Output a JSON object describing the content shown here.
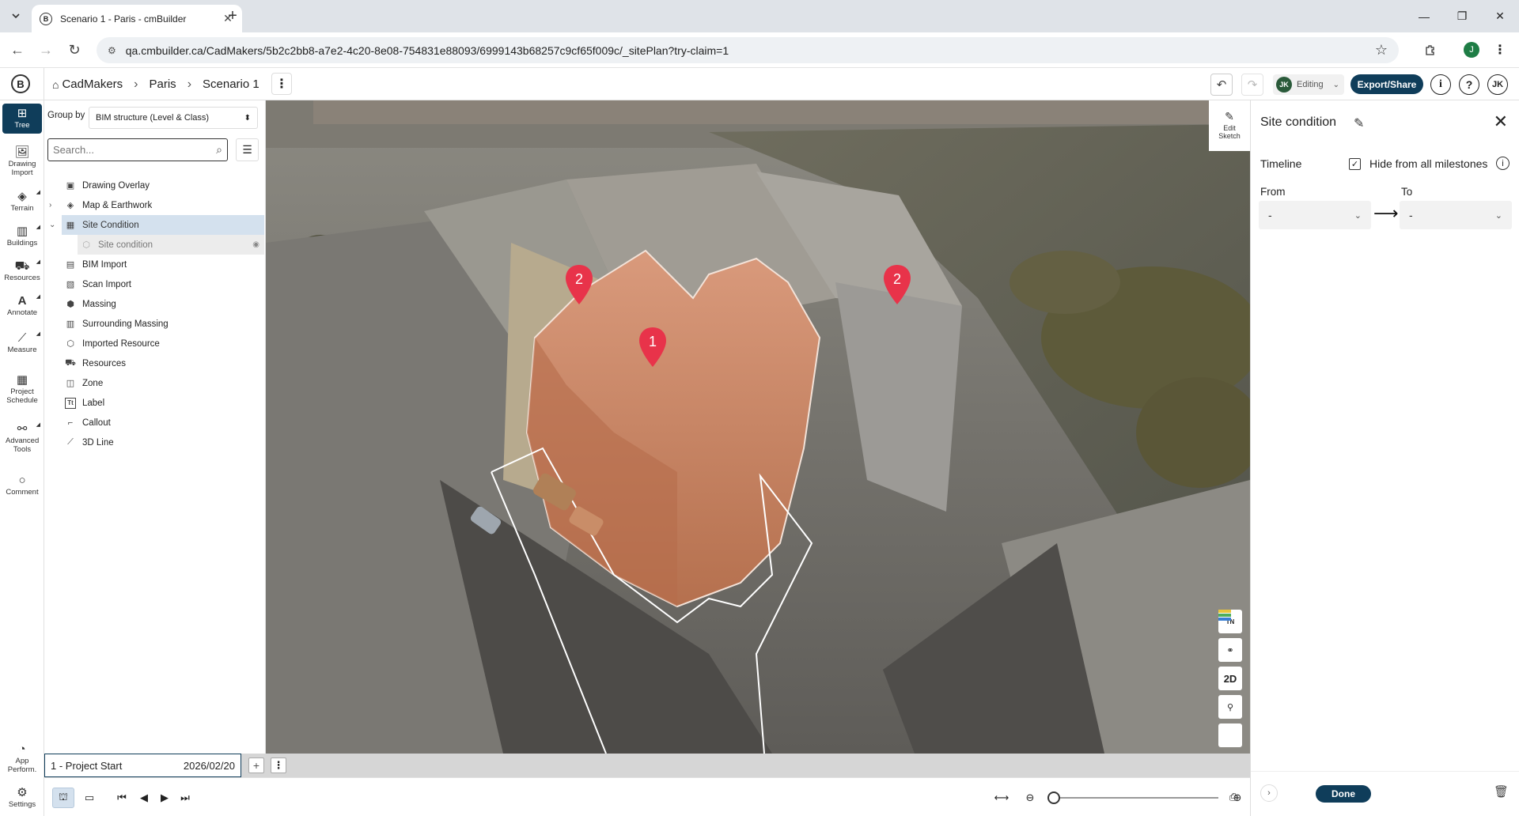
{
  "browser": {
    "tab_title": "Scenario 1 - Paris - cmBuilder",
    "url": "qa.cmbuilder.ca/CadMakers/5b2c2bb8-a7e2-4c20-8e08-754831e88093/6999143b68257c9cf65f009c/_sitePlan?try-claim=1",
    "profile_initial": "J"
  },
  "app": {
    "logo": "B",
    "breadcrumbs": [
      "CadMakers",
      "Paris",
      "Scenario 1"
    ],
    "editing_label": "Editing",
    "editing_avatar": "JK",
    "export_label": "Export/Share",
    "user_initials": "JK",
    "accent_color": "#0f3d5a"
  },
  "left_toolbar": [
    {
      "label": "Tree",
      "icon": "tree-icon"
    },
    {
      "label": "Drawing Import",
      "icon": "drawing-import-icon"
    },
    {
      "label": "Terrain",
      "icon": "terrain-icon"
    },
    {
      "label": "Buildings",
      "icon": "buildings-icon"
    },
    {
      "label": "Resources",
      "icon": "resources-icon"
    },
    {
      "label": "Annotate",
      "icon": "annotate-icon"
    },
    {
      "label": "Measure",
      "icon": "measure-icon"
    },
    {
      "label": "Project Schedule",
      "icon": "schedule-icon"
    },
    {
      "label": "Advanced Tools",
      "icon": "advanced-tools-icon"
    },
    {
      "label": "Comment",
      "icon": "comment-icon"
    },
    {
      "label": "App Perform.",
      "icon": "performance-icon"
    },
    {
      "label": "Settings",
      "icon": "settings-icon"
    }
  ],
  "tree_panel": {
    "group_by_label": "Group by",
    "group_by_value": "BIM structure (Level & Class)",
    "search_placeholder": "Search...",
    "items": [
      {
        "label": "Drawing Overlay",
        "icon": "drawing-overlay-icon"
      },
      {
        "label": "Map & Earthwork",
        "icon": "map-icon"
      },
      {
        "label": "Site Condition",
        "icon": "site-condition-icon"
      },
      {
        "label": "Site condition",
        "icon": "cube-icon"
      },
      {
        "label": "BIM Import",
        "icon": "bim-import-icon"
      },
      {
        "label": "Scan Import",
        "icon": "scan-import-icon"
      },
      {
        "label": "Massing",
        "icon": "massing-icon"
      },
      {
        "label": "Surrounding Massing",
        "icon": "surrounding-massing-icon"
      },
      {
        "label": "Imported Resource",
        "icon": "imported-resource-icon"
      },
      {
        "label": "Resources",
        "icon": "resources-icon"
      },
      {
        "label": "Zone",
        "icon": "zone-icon"
      },
      {
        "label": "Label",
        "icon": "label-icon"
      },
      {
        "label": "Callout",
        "icon": "callout-icon"
      },
      {
        "label": "3D Line",
        "icon": "line-icon"
      }
    ]
  },
  "viewport": {
    "edit_sketch_label": "Edit Sketch",
    "markers": [
      "2",
      "1",
      "2"
    ],
    "view_tools": [
      "TN",
      "layers",
      "2D",
      "pin",
      "legend"
    ]
  },
  "right_panel": {
    "title": "Site condition",
    "timeline_label": "Timeline",
    "hide_label": "Hide from all milestones",
    "hide_checked": true,
    "from_label": "From",
    "to_label": "To",
    "from_value": "-",
    "to_value": "-",
    "done_label": "Done"
  },
  "milestone": {
    "name": "1 - Project Start",
    "date": "2026/02/20"
  }
}
